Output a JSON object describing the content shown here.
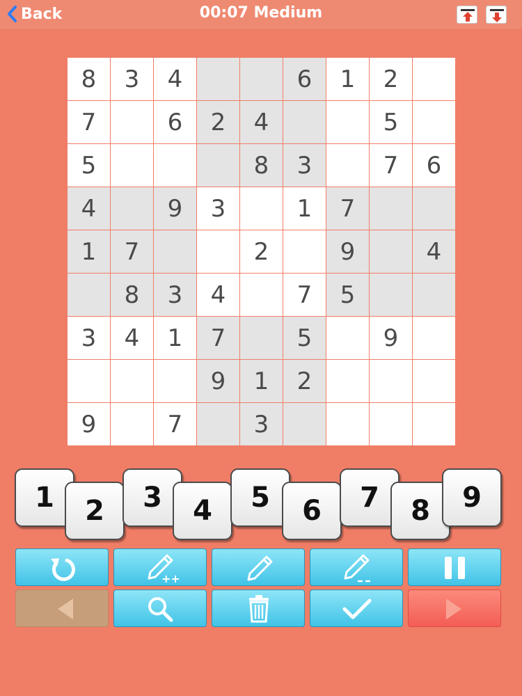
{
  "header": {
    "back_label": "Back",
    "title": "00:07 Medium",
    "icons": [
      "upload-icon",
      "download-icon"
    ]
  },
  "board": {
    "rows": [
      [
        "8",
        "3",
        "4",
        "",
        "",
        "6",
        "1",
        "2",
        ""
      ],
      [
        "7",
        "",
        "6",
        "2",
        "4",
        "",
        "",
        "5",
        ""
      ],
      [
        "5",
        "",
        "",
        "",
        "8",
        "3",
        "",
        "7",
        "6"
      ],
      [
        "4",
        "",
        "9",
        "3",
        "",
        "1",
        "7",
        "",
        ""
      ],
      [
        "1",
        "7",
        "",
        "",
        "2",
        "",
        "9",
        "",
        "4"
      ],
      [
        "",
        "8",
        "3",
        "4",
        "",
        "7",
        "5",
        "",
        ""
      ],
      [
        "3",
        "4",
        "1",
        "7",
        "",
        "5",
        "",
        "9",
        ""
      ],
      [
        "",
        "",
        "",
        "9",
        "1",
        "2",
        "",
        "",
        ""
      ],
      [
        "9",
        "",
        "7",
        "",
        "3",
        "",
        "",
        "",
        ""
      ]
    ]
  },
  "number_pad": [
    "1",
    "2",
    "3",
    "4",
    "5",
    "6",
    "7",
    "8",
    "9"
  ],
  "toolbar": {
    "row1": [
      "restart-icon",
      "pencil-plus-icon",
      "pencil-icon",
      "pencil-minus-icon",
      "pause-icon"
    ],
    "row2": [
      "previous-icon",
      "search-icon",
      "trash-icon",
      "check-icon",
      "next-icon"
    ]
  },
  "colors": {
    "background": "#f07d66",
    "header": "#ef8a72",
    "cell_white": "#ffffff",
    "cell_shaded": "#e4e4e4",
    "button_blue": "#41c3e7",
    "button_tan": "#c79e7a",
    "button_red": "#f35d55"
  }
}
